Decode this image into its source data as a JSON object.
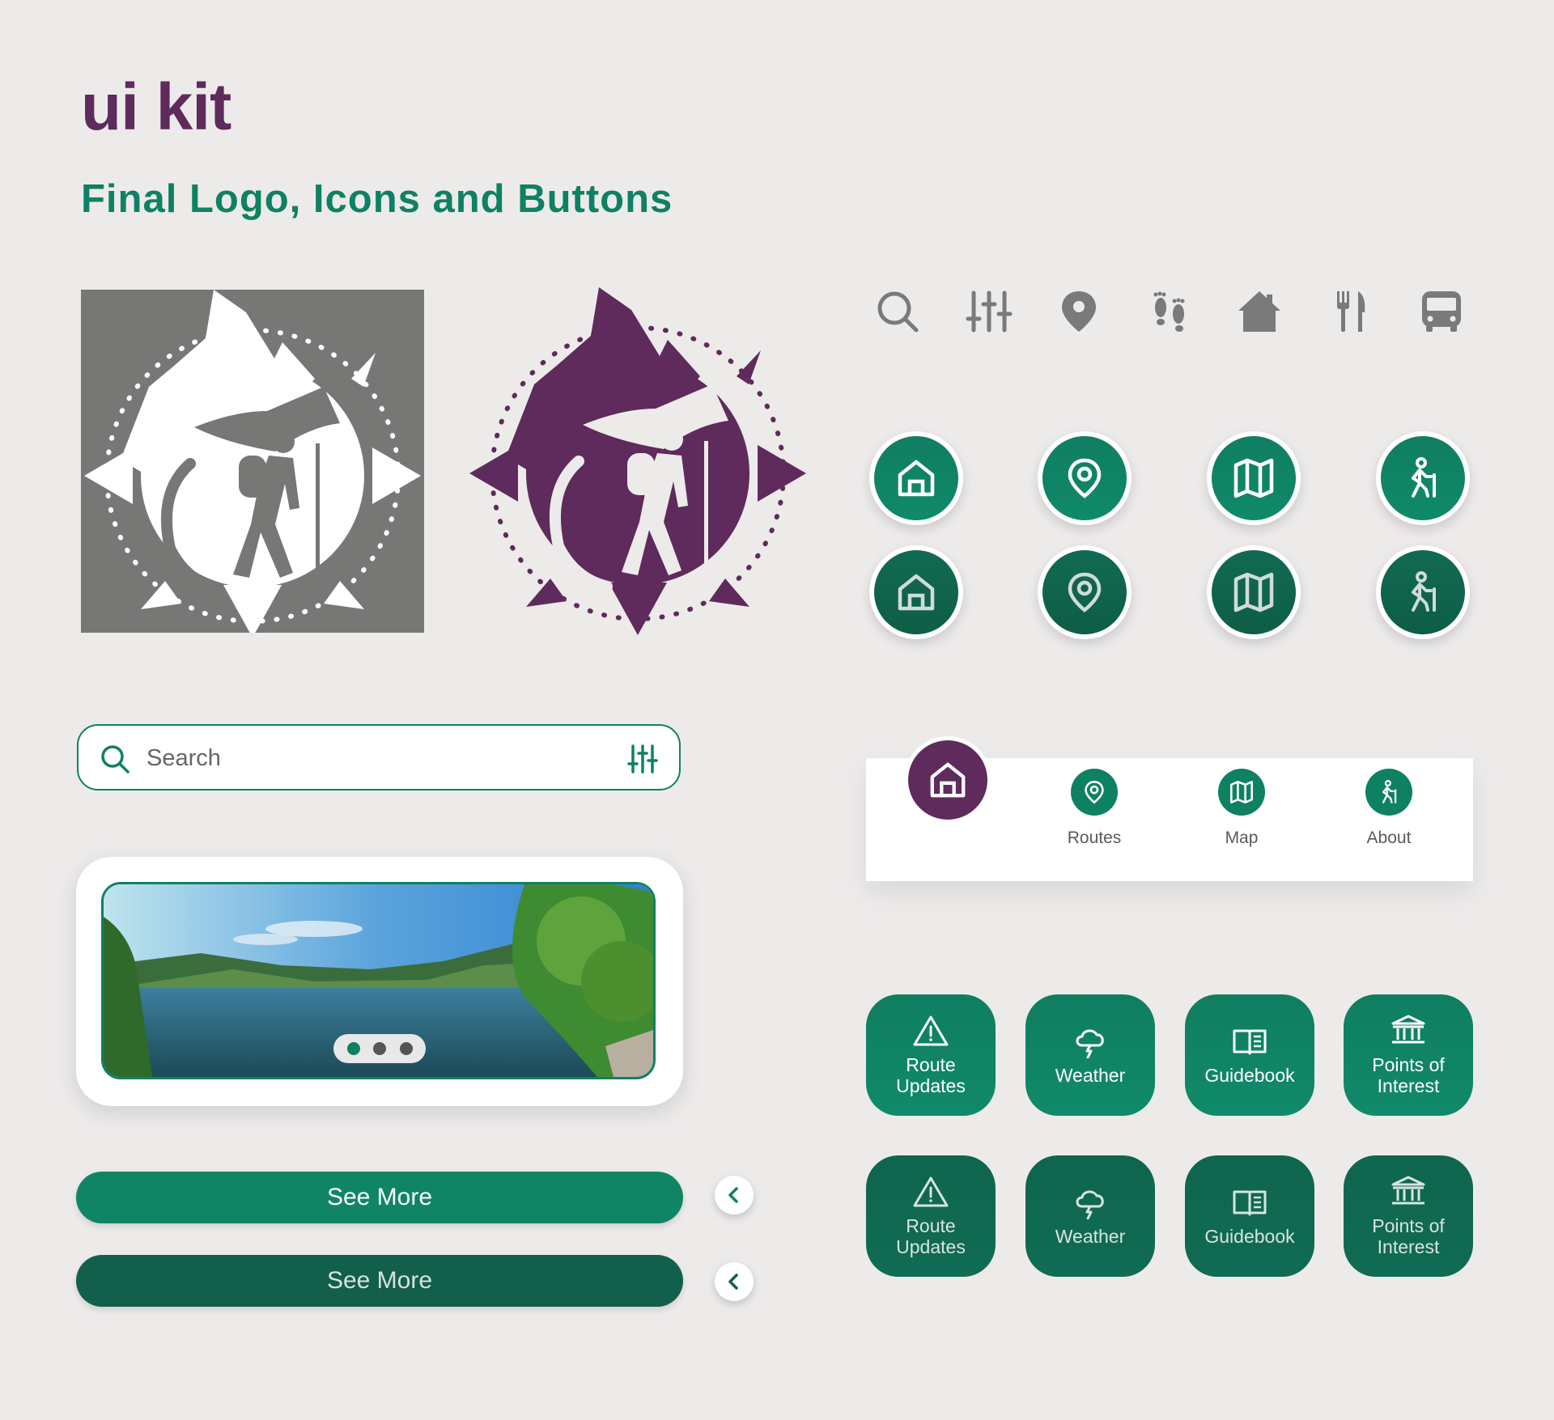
{
  "header": {
    "title": "ui kit",
    "subtitle": "Final Logo, Icons and Buttons"
  },
  "colors": {
    "brand_purple": "#5f2a5c",
    "brand_green": "#0f8163",
    "dark_green": "#125f4c",
    "background": "#edebea",
    "logo_gray": "#777775"
  },
  "logos": [
    {
      "name": "hiker-compass-logo-white-on-gray"
    },
    {
      "name": "hiker-compass-logo-purple"
    }
  ],
  "icon_row": [
    "search-icon",
    "sliders-icon",
    "location-pin-icon",
    "footprints-icon",
    "house-icon",
    "fork-knife-icon",
    "bus-icon"
  ],
  "round_buttons": [
    "home-icon",
    "location-pin-icon",
    "map-icon",
    "hiker-icon"
  ],
  "search": {
    "placeholder": "Search"
  },
  "carousel": {
    "slide_count": 3,
    "active_index": 0
  },
  "buttons": {
    "see_more": "See More",
    "see_more_pressed": "See More"
  },
  "nav": {
    "items": [
      {
        "label": "",
        "icon": "home-icon",
        "active": true
      },
      {
        "label": "Routes",
        "icon": "location-pin-icon"
      },
      {
        "label": "Map",
        "icon": "map-icon"
      },
      {
        "label": "About",
        "icon": "hiker-icon"
      }
    ]
  },
  "tiles": [
    {
      "label": "Route\nUpdates",
      "icon": "warning-icon"
    },
    {
      "label": "Weather",
      "icon": "weather-icon"
    },
    {
      "label": "Guidebook",
      "icon": "book-icon"
    },
    {
      "label": "Points of\nInterest",
      "icon": "museum-icon"
    }
  ],
  "tiles_pressed": [
    {
      "label": "Route\nUpdates",
      "icon": "warning-icon"
    },
    {
      "label": "Weather",
      "icon": "weather-icon"
    },
    {
      "label": "Guidebook",
      "icon": "book-icon"
    },
    {
      "label": "Points of\nInterest",
      "icon": "museum-icon"
    }
  ]
}
